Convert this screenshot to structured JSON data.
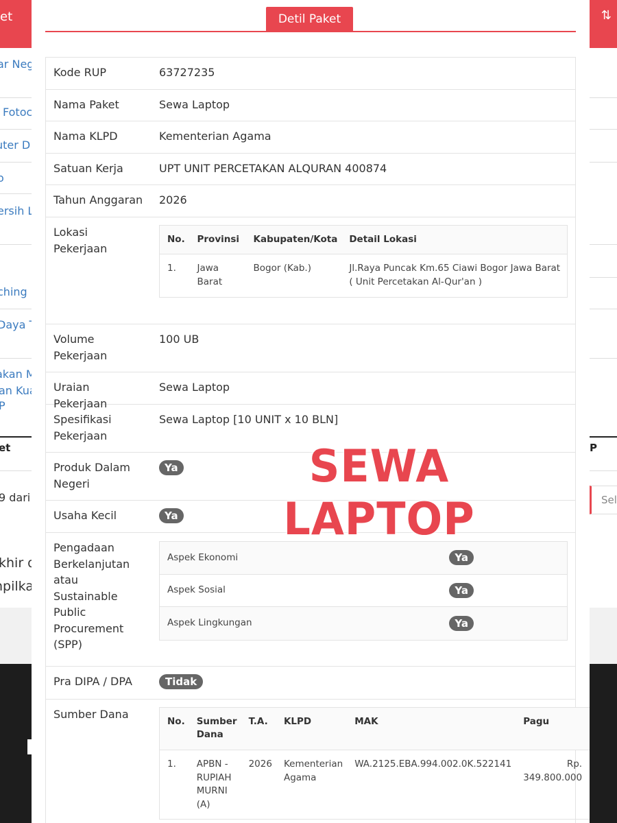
{
  "background": {
    "topbar_left_text": "et",
    "topbar_right_icon": "sort-icon",
    "left_links": [
      "ar Neg",
      "Fotoc",
      "uter D",
      "o",
      "ersih L",
      "ching",
      "Daya T",
      "akan M",
      "an Kua",
      "P"
    ],
    "left_bold": "et",
    "right_bold": "P",
    "left_text_1": "9 dari",
    "left_text_2": "khir d",
    "left_text_3": "npilka",
    "right_select_text": "Sel"
  },
  "modal": {
    "tab_title": "Detil Paket",
    "watermark": "SEWA LAPTOP",
    "rows": {
      "kode_rup": {
        "label": "Kode RUP",
        "value": "63727235"
      },
      "nama_paket": {
        "label": "Nama Paket",
        "value": "Sewa Laptop"
      },
      "nama_klpd": {
        "label": "Nama KLPD",
        "value": "Kementerian Agama"
      },
      "satuan_kerja": {
        "label": "Satuan Kerja",
        "value": "UPT UNIT PERCETAKAN ALQURAN 400874"
      },
      "tahun_anggaran": {
        "label": "Tahun Anggaran",
        "value": "2026"
      },
      "lokasi": {
        "label": "Lokasi Pekerjaan",
        "headers": [
          "No.",
          "Provinsi",
          "Kabupaten/Kota",
          "Detail Lokasi"
        ],
        "rows": [
          {
            "no": "1.",
            "provinsi": "Jawa Barat",
            "kabupaten": "Bogor (Kab.)",
            "detail": "Jl.Raya Puncak Km.65 Ciawi Bogor Jawa Barat ( Unit Percetakan Al-Qur'an )"
          }
        ]
      },
      "volume": {
        "label": "Volume Pekerjaan",
        "value": "100 UB"
      },
      "uraian": {
        "label": "Uraian Pekerjaan",
        "value": "Sewa Laptop"
      },
      "spesifikasi": {
        "label": "Spesifikasi Pekerjaan",
        "value": "Sewa Laptop [10 UNIT x 10 BLN]"
      },
      "produk_dalam_negeri": {
        "label": "Produk Dalam Negeri",
        "value": "Ya"
      },
      "usaha_kecil": {
        "label": "Usaha Kecil",
        "value": "Ya"
      },
      "spp": {
        "label": "Pengadaan Berkelanjutan atau Sustainable Public Procurement (SPP)",
        "items": [
          {
            "aspek": "Aspek Ekonomi",
            "value": "Ya"
          },
          {
            "aspek": "Aspek Sosial",
            "value": "Ya"
          },
          {
            "aspek": "Aspek Lingkungan",
            "value": "Ya"
          }
        ]
      },
      "pra_dipa": {
        "label": "Pra DIPA / DPA",
        "value": "Tidak"
      },
      "sumber_dana": {
        "label": "Sumber Dana",
        "headers": [
          "No.",
          "Sumber Dana",
          "T.A.",
          "KLPD",
          "MAK",
          "Pagu"
        ],
        "rows": [
          {
            "no": "1.",
            "sumber": "APBN - RUPIAH MURNI (A)",
            "ta": "2026",
            "klpd": "Kementerian Agama",
            "mak": "WA.2125.EBA.994.002.0K.522141",
            "pagu": "Rp. 349.800.000"
          }
        ]
      }
    }
  }
}
